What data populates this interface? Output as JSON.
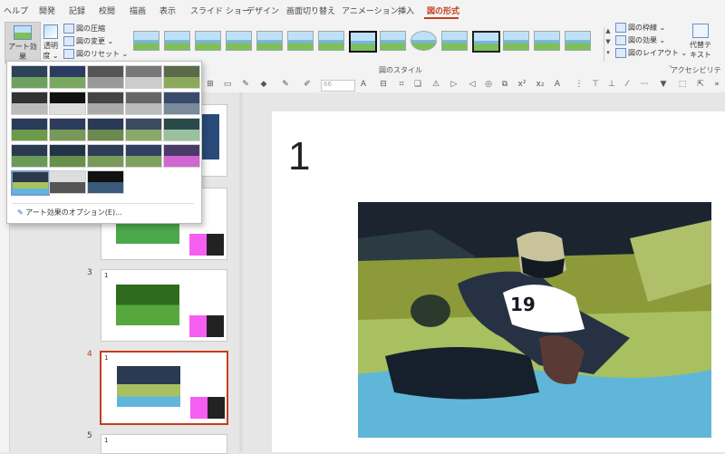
{
  "tabs": [
    {
      "label": "ヘルプ"
    },
    {
      "label": "開発"
    },
    {
      "label": "記録"
    },
    {
      "label": "校閲"
    },
    {
      "label": "描画"
    },
    {
      "label": "表示"
    },
    {
      "label": "スライド ショー"
    },
    {
      "label": "デザイン"
    },
    {
      "label": "画面切り替え"
    },
    {
      "label": "アニメーション"
    },
    {
      "label": "挿入"
    },
    {
      "label": "図の形式"
    }
  ],
  "ribbon": {
    "art_effects": {
      "line1": "アート効果",
      "line2": "⌄"
    },
    "transparency": {
      "line1": "透明",
      "line2": "度 ⌄"
    },
    "compress": "図の圧縮",
    "change": "図の変更 ⌄",
    "reset": "図のリセット ⌄",
    "picture_styles_label": "図のスタイル",
    "border": "図の枠線 ⌄",
    "effects": "図の効果 ⌄",
    "layout": "図のレイアウト ⌄",
    "alt_text": {
      "line1": "代替テ",
      "line2": "キスト"
    },
    "accessibility_label": "アクセシビリティ",
    "font_size_placeholder": "66"
  },
  "dropdown": {
    "option_label": "アート効果のオプション(E)...",
    "effects": [
      "none",
      "marker",
      "pencil-grayscale",
      "pencil-sketch",
      "line-drawing",
      "chalk-sketch",
      "paint-strokes",
      "paint-brush",
      "glow-diffused",
      "blur",
      "light-screen",
      "watercolor-sponge",
      "film-grain",
      "mosaic-bubbles",
      "glass",
      "cement",
      "texturizer",
      "crisscross-etching",
      "pastels-smooth",
      "plastic-wrap",
      "cutout",
      "photocopy",
      "glow-edges"
    ],
    "selected": "cutout"
  },
  "slides": [
    {
      "number": "",
      "selected": false
    },
    {
      "number": "",
      "selected": false
    },
    {
      "number": "3",
      "selected": false
    },
    {
      "number": "4",
      "selected": true
    },
    {
      "number": "5",
      "selected": false
    }
  ],
  "slide_thumb_label": "1",
  "main_slide": {
    "title": "1"
  },
  "colors": {
    "accent": "#c43e1c",
    "ribbon_bg": "#f3f3f3",
    "canvas_bg": "#e6e6e6"
  }
}
